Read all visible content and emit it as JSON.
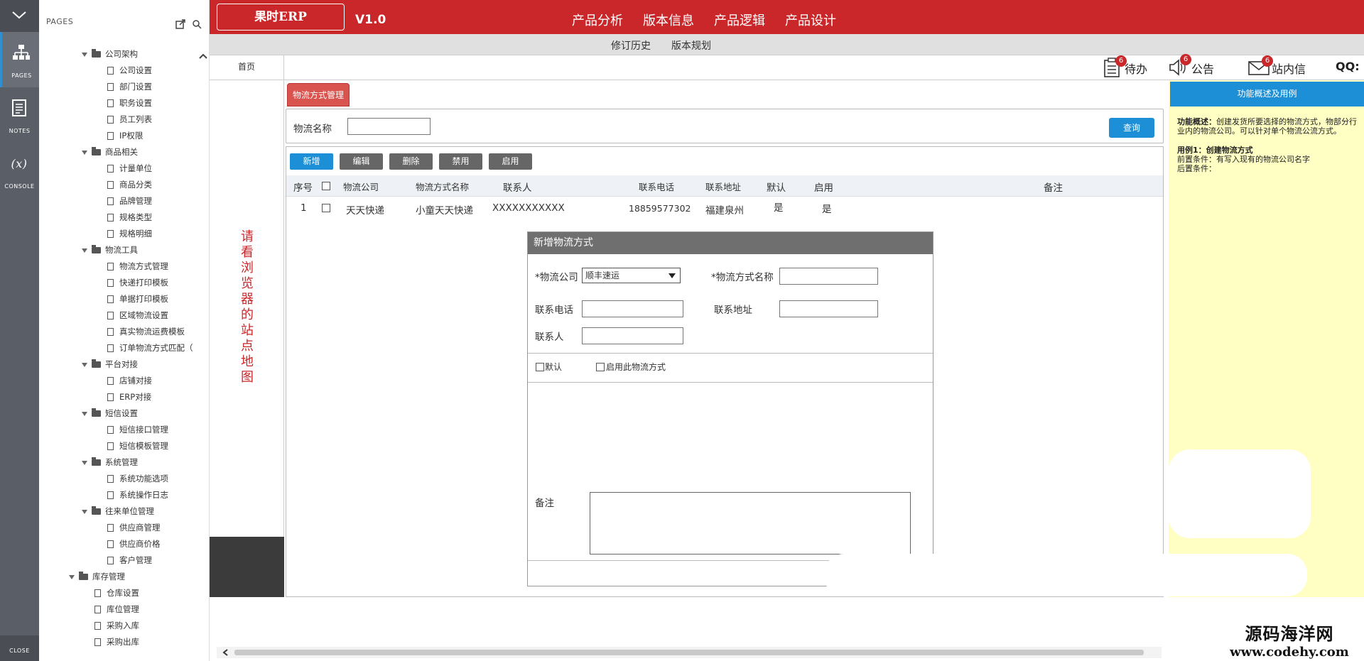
{
  "rail": {
    "pages_label": "PAGES",
    "notes_label": "NOTES",
    "console_label": "CONSOLE",
    "close_label": "CLOSE"
  },
  "pages_panel": {
    "title": "PAGES",
    "tree": [
      {
        "level": 1,
        "kind": "folder",
        "label": "公司架构"
      },
      {
        "level": 2,
        "kind": "file",
        "label": "公司设置"
      },
      {
        "level": 2,
        "kind": "file",
        "label": "部门设置"
      },
      {
        "level": 2,
        "kind": "file",
        "label": "职务设置"
      },
      {
        "level": 2,
        "kind": "file",
        "label": "员工列表"
      },
      {
        "level": 2,
        "kind": "file",
        "label": "IP权限"
      },
      {
        "level": 1,
        "kind": "folder",
        "label": "商品相关"
      },
      {
        "level": 2,
        "kind": "file",
        "label": "计量单位"
      },
      {
        "level": 2,
        "kind": "file",
        "label": "商品分类"
      },
      {
        "level": 2,
        "kind": "file",
        "label": "品牌管理"
      },
      {
        "level": 2,
        "kind": "file",
        "label": "规格类型"
      },
      {
        "level": 2,
        "kind": "file",
        "label": "规格明细"
      },
      {
        "level": 1,
        "kind": "folder",
        "label": "物流工具"
      },
      {
        "level": 2,
        "kind": "file",
        "label": "物流方式管理"
      },
      {
        "level": 2,
        "kind": "file",
        "label": "快递打印模板"
      },
      {
        "level": 2,
        "kind": "file",
        "label": "单据打印模板"
      },
      {
        "level": 2,
        "kind": "file",
        "label": "区域物流设置"
      },
      {
        "level": 2,
        "kind": "file",
        "label": "真实物流运费模板"
      },
      {
        "level": 2,
        "kind": "file",
        "label": "订单物流方式匹配（"
      },
      {
        "level": 1,
        "kind": "folder",
        "label": "平台对接"
      },
      {
        "level": 2,
        "kind": "file",
        "label": "店铺对接"
      },
      {
        "level": 2,
        "kind": "file",
        "label": "ERP对接"
      },
      {
        "level": 1,
        "kind": "folder",
        "label": "短信设置"
      },
      {
        "level": 2,
        "kind": "file",
        "label": "短信接口管理"
      },
      {
        "level": 2,
        "kind": "file",
        "label": "短信模板管理"
      },
      {
        "level": 1,
        "kind": "folder",
        "label": "系统管理"
      },
      {
        "level": 2,
        "kind": "file",
        "label": "系统功能选项"
      },
      {
        "level": 2,
        "kind": "file",
        "label": "系统操作日志"
      },
      {
        "level": 1,
        "kind": "folder",
        "label": "往来单位管理"
      },
      {
        "level": 2,
        "kind": "file",
        "label": "供应商管理"
      },
      {
        "level": 2,
        "kind": "file",
        "label": "供应商价格"
      },
      {
        "level": 2,
        "kind": "file",
        "label": "客户管理"
      },
      {
        "level": 0,
        "kind": "folder",
        "label": "库存管理"
      },
      {
        "level": 1,
        "kind": "file",
        "label": "仓库设置"
      },
      {
        "level": 1,
        "kind": "file",
        "label": "库位管理"
      },
      {
        "level": 1,
        "kind": "file",
        "label": "采购入库"
      },
      {
        "level": 1,
        "kind": "file",
        "label": "采购出库"
      }
    ]
  },
  "header": {
    "logo": "果时ERP",
    "version": "V1.0",
    "nav": [
      "产品分析",
      "版本信息",
      "产品逻辑",
      "产品设计"
    ],
    "subnav": [
      "修订历史",
      "版本规划"
    ]
  },
  "tabbar": {
    "home": "首页",
    "todo_label": "待办",
    "todo_count": "6",
    "notice_label": "公告",
    "notice_count": "6",
    "message_label": "站内信",
    "message_count": "6",
    "qq_label": "QQ:"
  },
  "sitemap": {
    "text": "请看浏览器的站点地图"
  },
  "main": {
    "page_tab": "物流方式管理",
    "search_label": "物流名称",
    "search_value": "",
    "query_button": "查询",
    "toolbar": [
      "新增",
      "编辑",
      "删除",
      "禁用",
      "启用"
    ],
    "columns": [
      "序号",
      "物流公司",
      "物流方式名称",
      "联系人",
      "联系电话",
      "联系地址",
      "默认",
      "启用",
      "备注"
    ],
    "rows": [
      {
        "no": "1",
        "company": "天天快递",
        "method": "小童天天快递",
        "contact": "XXXXXXXXXXX",
        "phone": "18859577302",
        "address": "福建泉州",
        "default": "是",
        "enabled": "是",
        "remark": ""
      }
    ]
  },
  "modal": {
    "title": "新增物流方式",
    "company_label": "*物流公司",
    "company_value": "顺丰速运",
    "method_label": "*物流方式名称",
    "phone_label": "联系电话",
    "address_label": "联系地址",
    "contact_label": "联系人",
    "default_label": "默认",
    "enable_label": "启用此物流方式",
    "remark_label": "备注"
  },
  "right_panel": {
    "button": "功能概述及用例",
    "overview_title": "功能概述：",
    "overview_text": "创建发货所要选择的物流方式，物部分行业内的物流公司。可以针对单个物流公流方式。",
    "case_title": "用例1：创建物流方式",
    "pre_condition": "前置条件：有写入现有的物流公司名字",
    "post_condition": "后置条件："
  },
  "watermark": {
    "line1": "源码海洋网",
    "line2": "www.codehy.com"
  },
  "colors": {
    "brand_red": "#c9272a",
    "accent_blue": "#1c8fd6",
    "panel_yellow": "#ffffc4"
  }
}
